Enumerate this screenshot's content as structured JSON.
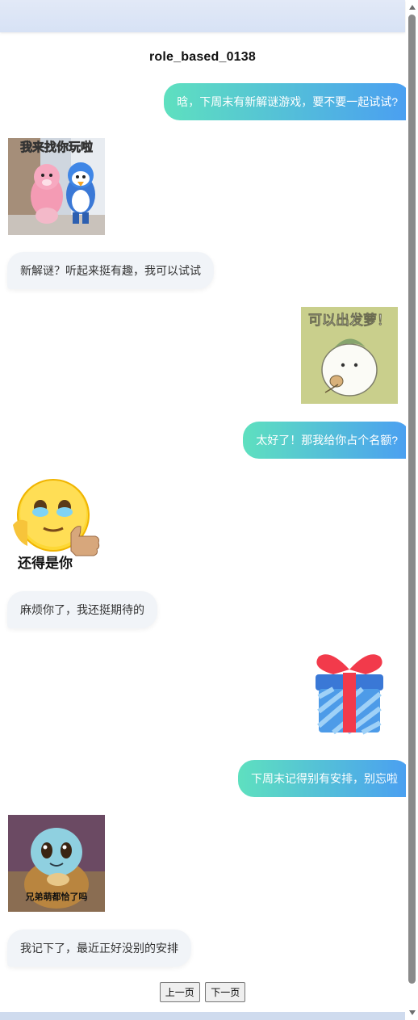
{
  "title": "role_based_0138",
  "messages": [
    {
      "side": "right",
      "type": "text",
      "text": "晗，下周末有新解谜游戏，要不要一起试试?"
    },
    {
      "side": "left",
      "type": "sticker",
      "caption": "我来找你玩啦",
      "icon": "penguin-friends-sticker"
    },
    {
      "side": "left",
      "type": "text",
      "text": "新解谜？听起来挺有趣，我可以试试"
    },
    {
      "side": "right",
      "type": "sticker",
      "caption": "可以出发萝！",
      "icon": "radish-sticker"
    },
    {
      "side": "right",
      "type": "text",
      "text": "太好了！那我给你占个名额?"
    },
    {
      "side": "left",
      "type": "sticker",
      "caption": "还得是你",
      "icon": "teary-thumbs-up-emoji"
    },
    {
      "side": "left",
      "type": "text",
      "text": "麻烦你了，我还挺期待的"
    },
    {
      "side": "right",
      "type": "sticker",
      "caption": "",
      "icon": "gift-icon"
    },
    {
      "side": "right",
      "type": "text",
      "text": "下周末记得别有安排，别忘啦"
    },
    {
      "side": "left",
      "type": "sticker",
      "caption": "兄弟萌都恰了吗",
      "icon": "squirtle-sticker"
    },
    {
      "side": "left",
      "type": "text",
      "text": "我记下了，最近正好没别的安排"
    }
  ],
  "pager": {
    "prev": "上一页",
    "next": "下一页"
  },
  "colors": {
    "bubble_right_start": "#5ee0bf",
    "bubble_right_end": "#4a9ef2",
    "bubble_left": "#f1f4f8",
    "header": "#dce6f7"
  }
}
